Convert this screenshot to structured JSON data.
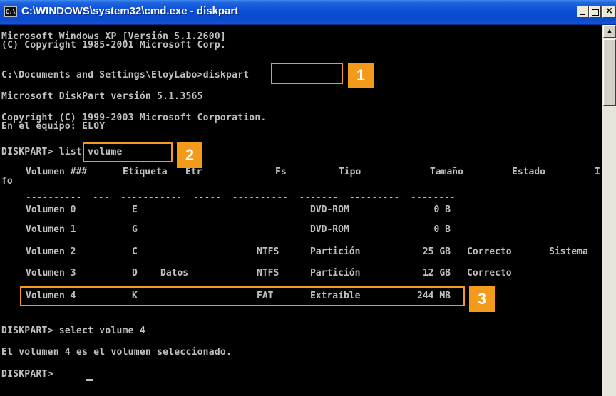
{
  "window": {
    "title": "C:\\WINDOWS\\system32\\cmd.exe - diskpart",
    "icon": "C:\\",
    "controls": {
      "minimize": "minimize-icon",
      "maximize": "maximize-icon",
      "close": "×"
    }
  },
  "console": {
    "header": [
      "Microsoft Windows XP [Versión 5.1.2600]",
      "(C) Copyright 1985-2001 Microsoft Corp."
    ],
    "prompt1": "C:\\Documents and Settings\\EloyLabo>",
    "cmd1": "diskpart",
    "diskpart_version": "Microsoft DiskPart versión 5.1.3565",
    "copyright": "Copyright (C) 1999-2003 Microsoft Corporation.",
    "machine": "En el equipo: ELOY",
    "prompt2": "DISKPART> ",
    "cmd2": "list volume",
    "table": {
      "header": [
        "Volumen ###",
        "Etiqueta",
        "Etr",
        "Fs",
        "Tipo",
        "Tamaño",
        "Estado",
        "I"
      ],
      "header_wrap": "fo",
      "separator": "----------  ---  -----------  -----  ----------  -------  ---------  --------",
      "rows": [
        [
          "Volumen 0",
          "E",
          "",
          "",
          "DVD-ROM",
          "0 B",
          "",
          ""
        ],
        [
          "Volumen 1",
          "G",
          "",
          "",
          "DVD-ROM",
          "0 B",
          "",
          ""
        ],
        [
          "Volumen 2",
          "C",
          "",
          "NTFS",
          "Partición",
          "25 GB",
          "Correcto",
          "Sistema"
        ],
        [
          "Volumen 3",
          "D",
          "Datos",
          "NTFS",
          "Partición",
          "12 GB",
          "Correcto",
          ""
        ],
        [
          "Volumen 4",
          "K",
          "",
          "FAT",
          "Extraíble",
          "244 MB",
          "",
          ""
        ]
      ]
    },
    "cmd3": "DISKPART> select volume 4",
    "selected_msg": "El volumen 4 es el volumen seleccionado.",
    "prompt3": "DISKPART> "
  },
  "callouts": {
    "badge1": "1",
    "badge2": "2",
    "badge3": "3",
    "color": "#f39a1b"
  },
  "scrollbar": {
    "up_arrow": "▲"
  }
}
